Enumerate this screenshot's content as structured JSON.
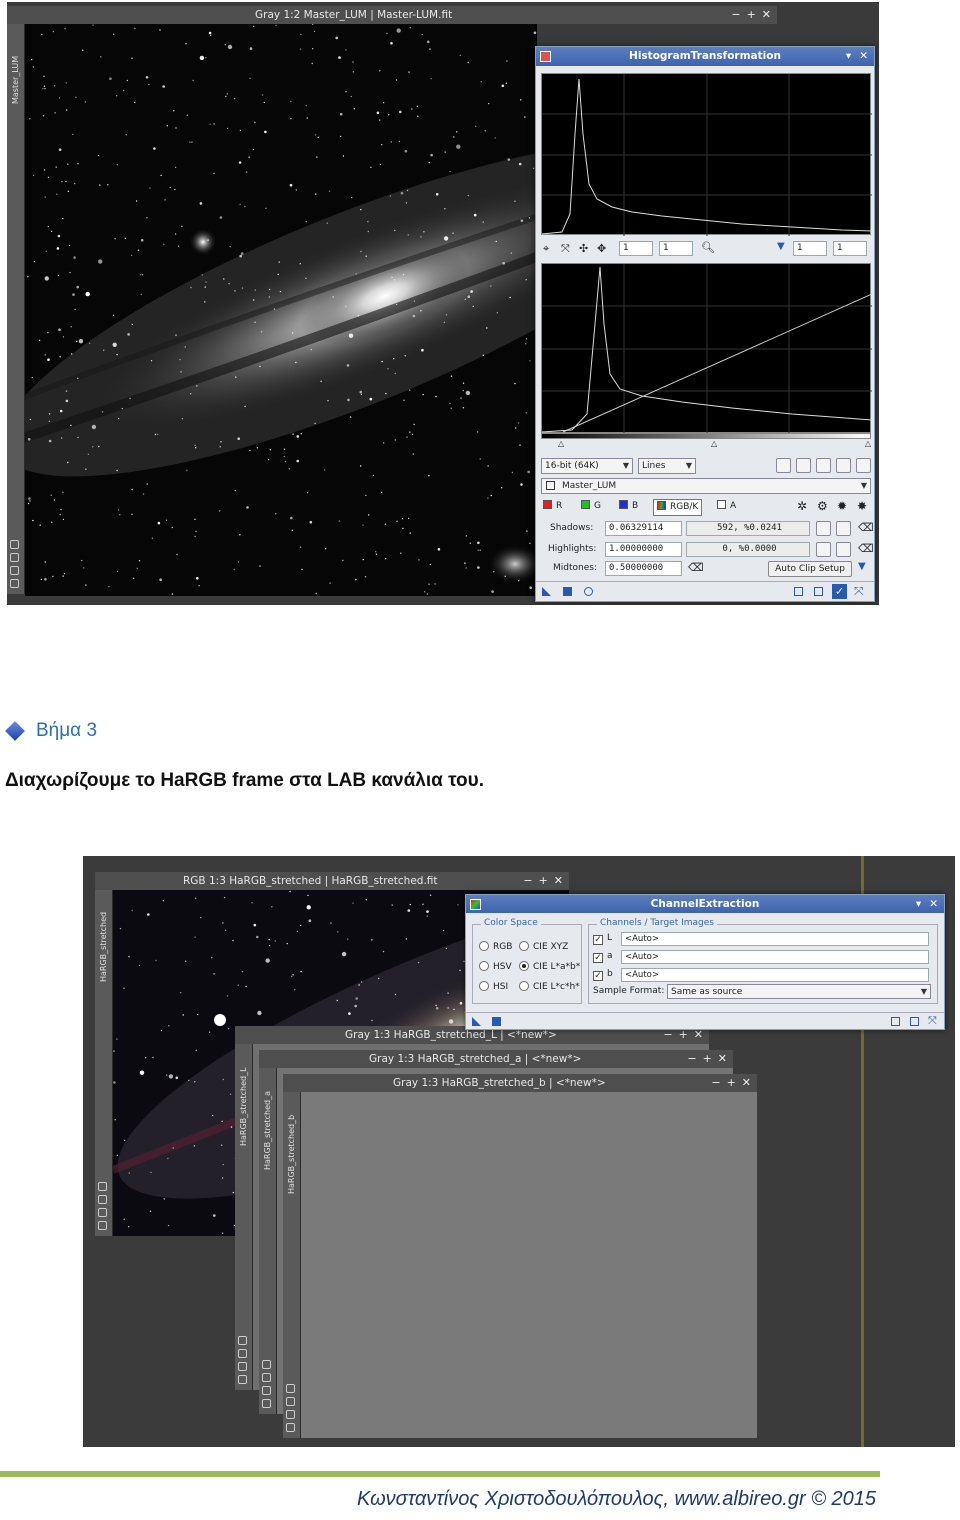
{
  "screenshot1": {
    "image_window": {
      "title": "Gray 1:2 Master_LUM | Master-LUM.fit",
      "side_label": "Master_LUM",
      "controls": [
        "−",
        "+",
        "✕"
      ]
    },
    "histogram_window": {
      "title": "HistogramTransformation",
      "close": "✕",
      "zoom_h": "1",
      "zoom_v": "1",
      "zoom_h2": "1",
      "zoom_v2": "1",
      "bit_depth": "16-bit (64K)",
      "graph_style": "Lines",
      "target_view": "Master_LUM",
      "channels": {
        "r": "R",
        "g": "G",
        "b": "B",
        "rgbk": "RGB/K",
        "a": "A"
      },
      "shadows_label": "Shadows:",
      "shadows_value": "0.06329114",
      "shadows_stats": "592, %0.0241",
      "highlights_label": "Highlights:",
      "highlights_value": "1.00000000",
      "highlights_stats": "0, %0.0000",
      "midtones_label": "Midtones:",
      "midtones_value": "0.50000000",
      "auto_clip": "Auto Clip Setup"
    }
  },
  "step": {
    "title": "Βήμα 3",
    "description": "Διαχωρίζουμε το HaRGB frame στα LAB κανάλια του."
  },
  "screenshot2": {
    "rgb_window": {
      "title": "RGB 1:3 HaRGB_stretched | HaRGB_stretched.fit",
      "side_label": "HaRGB_stretched"
    },
    "l_window": {
      "title": "Gray 1:3 HaRGB_stretched_L | <*new*>",
      "side_label": "HaRGB_stretched_L"
    },
    "a_window": {
      "title": "Gray 1:3 HaRGB_stretched_a | <*new*>",
      "side_label": "HaRGB_stretched_a"
    },
    "b_window": {
      "title": "Gray 1:3 HaRGB_stretched_b | <*new*>",
      "side_label": "HaRGB_stretched_b"
    },
    "controls": [
      "−",
      "+",
      "✕"
    ],
    "channel_extraction": {
      "title": "ChannelExtraction",
      "color_space_label": "Color Space",
      "options": {
        "rgb": "RGB",
        "hsv": "HSV",
        "hsi": "HSI",
        "ciexyz": "CIE XYZ",
        "cielab": "CIE L*a*b*",
        "cielch": "CIE L*c*h*"
      },
      "selected": "CIE L*a*b*",
      "channels_label": "Channels / Target Images",
      "channel_l": "L",
      "channel_a": "a",
      "channel_b": "b",
      "target_l": "<Auto>",
      "target_a": "<Auto>",
      "target_b": "<Auto>",
      "sample_format_label": "Sample Format:",
      "sample_format_value": "Same as source"
    }
  },
  "footer": {
    "text": "Κωνσταντίνος Χριστοδουλόπουλος, www.albireo.gr © 2015",
    "rule_color": "#9bbb59"
  }
}
